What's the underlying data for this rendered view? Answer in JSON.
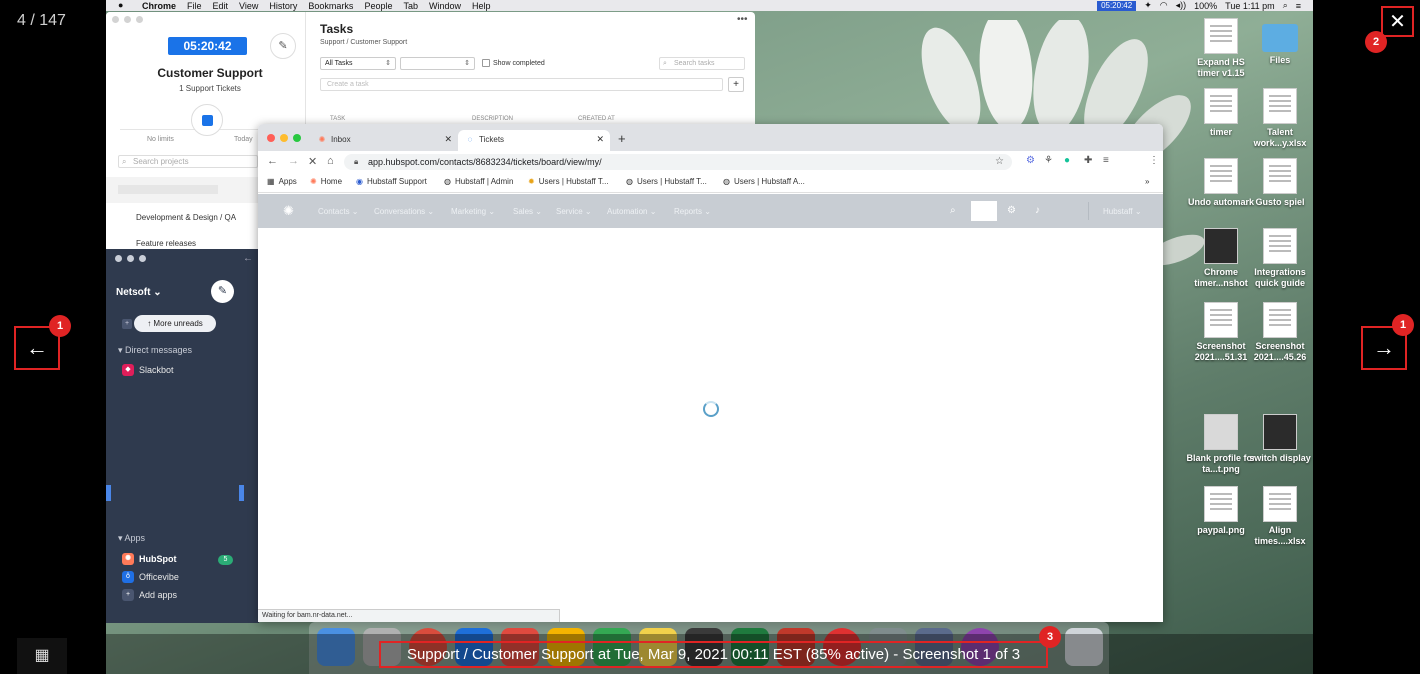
{
  "viewer": {
    "counter": "4 / 147",
    "caption": "Support / Customer Support at Tue, Mar 9, 2021 00:11 EST (85% active) - Screenshot 1 of 3",
    "badges": {
      "prev": "1",
      "next": "1",
      "close": "2",
      "caption": "3"
    },
    "prev_icon": "←",
    "next_icon": "→",
    "close_icon": "✕",
    "grid_icon": "▦"
  },
  "menubar": {
    "apple": "",
    "items": [
      "Chrome",
      "File",
      "Edit",
      "View",
      "History",
      "Bookmarks",
      "People",
      "Tab",
      "Window",
      "Help"
    ],
    "timer": "05:20:42",
    "battery": "100%",
    "clock": "Tue 1:11 pm"
  },
  "hubstaff": {
    "timer": "05:20:42",
    "project": "Customer Support",
    "tickets": "1 Support Tickets",
    "no_limits": "No limits",
    "today": "Today",
    "search_projects": "Search projects",
    "projects": [
      "Development & Design / QA",
      "Feature releases"
    ],
    "tasks_title": "Tasks",
    "tasks_sub": "Support / Customer Support",
    "filter": "All Tasks",
    "show_completed": "Show completed",
    "search_tasks": "Search tasks",
    "create_task": "Create a task",
    "columns": [
      "TASK",
      "DESCRIPTION",
      "CREATED AT"
    ]
  },
  "slack": {
    "workspace": "Netsoft ⌄",
    "more_unreads": "↑  More unreads",
    "direct_messages": "▾  Direct messages",
    "slackbot": "Slackbot",
    "apps": "▾  Apps",
    "hubspot": "HubSpot",
    "hubspot_badge": "5",
    "officevibe": "Officevibe",
    "add_apps": "Add apps"
  },
  "chrome": {
    "tabs": [
      {
        "label": "Inbox"
      },
      {
        "label": "Tickets"
      }
    ],
    "url": "app.hubspot.com/contacts/8683234/tickets/board/view/my/",
    "bookmarks": [
      "Apps",
      "Home",
      "Hubstaff Support",
      "Hubstaff | Admin",
      "Users | Hubstaff T...",
      "Users | Hubstaff T...",
      "Users | Hubstaff A..."
    ],
    "more_bookmarks": "»",
    "status": "Waiting for bam.nr-data.net..."
  },
  "hubspot": {
    "nav": [
      "Contacts ⌄",
      "Conversations ⌄",
      "Marketing ⌄",
      "Sales ⌄",
      "Service ⌄",
      "Automation ⌄",
      "Reports ⌄"
    ],
    "user": "Hubstaff ⌄"
  },
  "desktop": {
    "icons": [
      {
        "label": "Expand HS timer v1.15",
        "kind": "doc"
      },
      {
        "label": "Files",
        "kind": "folder"
      },
      {
        "label": "timer",
        "kind": "doc"
      },
      {
        "label": "Talent work...y.xlsx",
        "kind": "doc"
      },
      {
        "label": "Undo automark",
        "kind": "doc"
      },
      {
        "label": "Gusto spiel",
        "kind": "doc"
      },
      {
        "label": "Chrome timer...nshot",
        "kind": "dark"
      },
      {
        "label": "Integrations quick guide",
        "kind": "doc"
      },
      {
        "label": "Screenshot 2021....51.31",
        "kind": "doc"
      },
      {
        "label": "Screenshot 2021....45.26",
        "kind": "doc"
      },
      {
        "label": "Blank profile for ta...t.png",
        "kind": "person"
      },
      {
        "label": "switch display",
        "kind": "dark"
      },
      {
        "label": "paypal.png",
        "kind": "doc"
      },
      {
        "label": "Align times....xlsx",
        "kind": "doc"
      }
    ]
  }
}
